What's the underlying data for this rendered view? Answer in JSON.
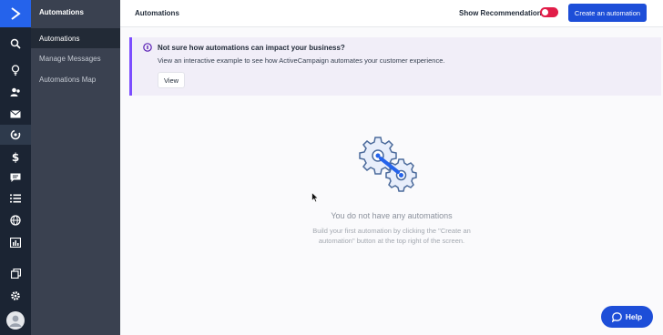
{
  "rail": {
    "logo_icon": "chevron-right-logo",
    "icons": [
      "search-icon",
      "lightbulb-icon",
      "contacts-icon",
      "campaigns-icon",
      "automations-icon",
      "deals-icon",
      "conversations-icon",
      "lists-icon",
      "site-icon",
      "reports-icon",
      "pages-icon",
      "settings-icon",
      "avatar-icon"
    ],
    "active_icon": "automations-icon"
  },
  "subnav": {
    "title": "Automations",
    "items": [
      {
        "label": "Automations",
        "active": true
      },
      {
        "label": "Manage Messages",
        "active": false
      },
      {
        "label": "Automations Map",
        "active": false
      }
    ]
  },
  "topbar": {
    "title": "Automations",
    "recommendations_label": "Show Recommendations",
    "recommendations_on": true,
    "create_button": "Create an automation"
  },
  "banner": {
    "title": "Not sure how automations can impact your business?",
    "text": "View an interactive example to see how ActiveCampaign automates your customer experience.",
    "view_button": "View"
  },
  "empty_state": {
    "title": "You do not have any automations",
    "description": "Build your first automation by clicking the \"Create an automation\" button at the top right of the screen."
  },
  "help": {
    "label": "Help"
  },
  "colors": {
    "brand": "#1d4ed8",
    "rail_bg": "#1b2433",
    "subnav_bg": "#3a4150",
    "banner_accent": "#7c4dff",
    "toggle_on": "#e11d48"
  }
}
